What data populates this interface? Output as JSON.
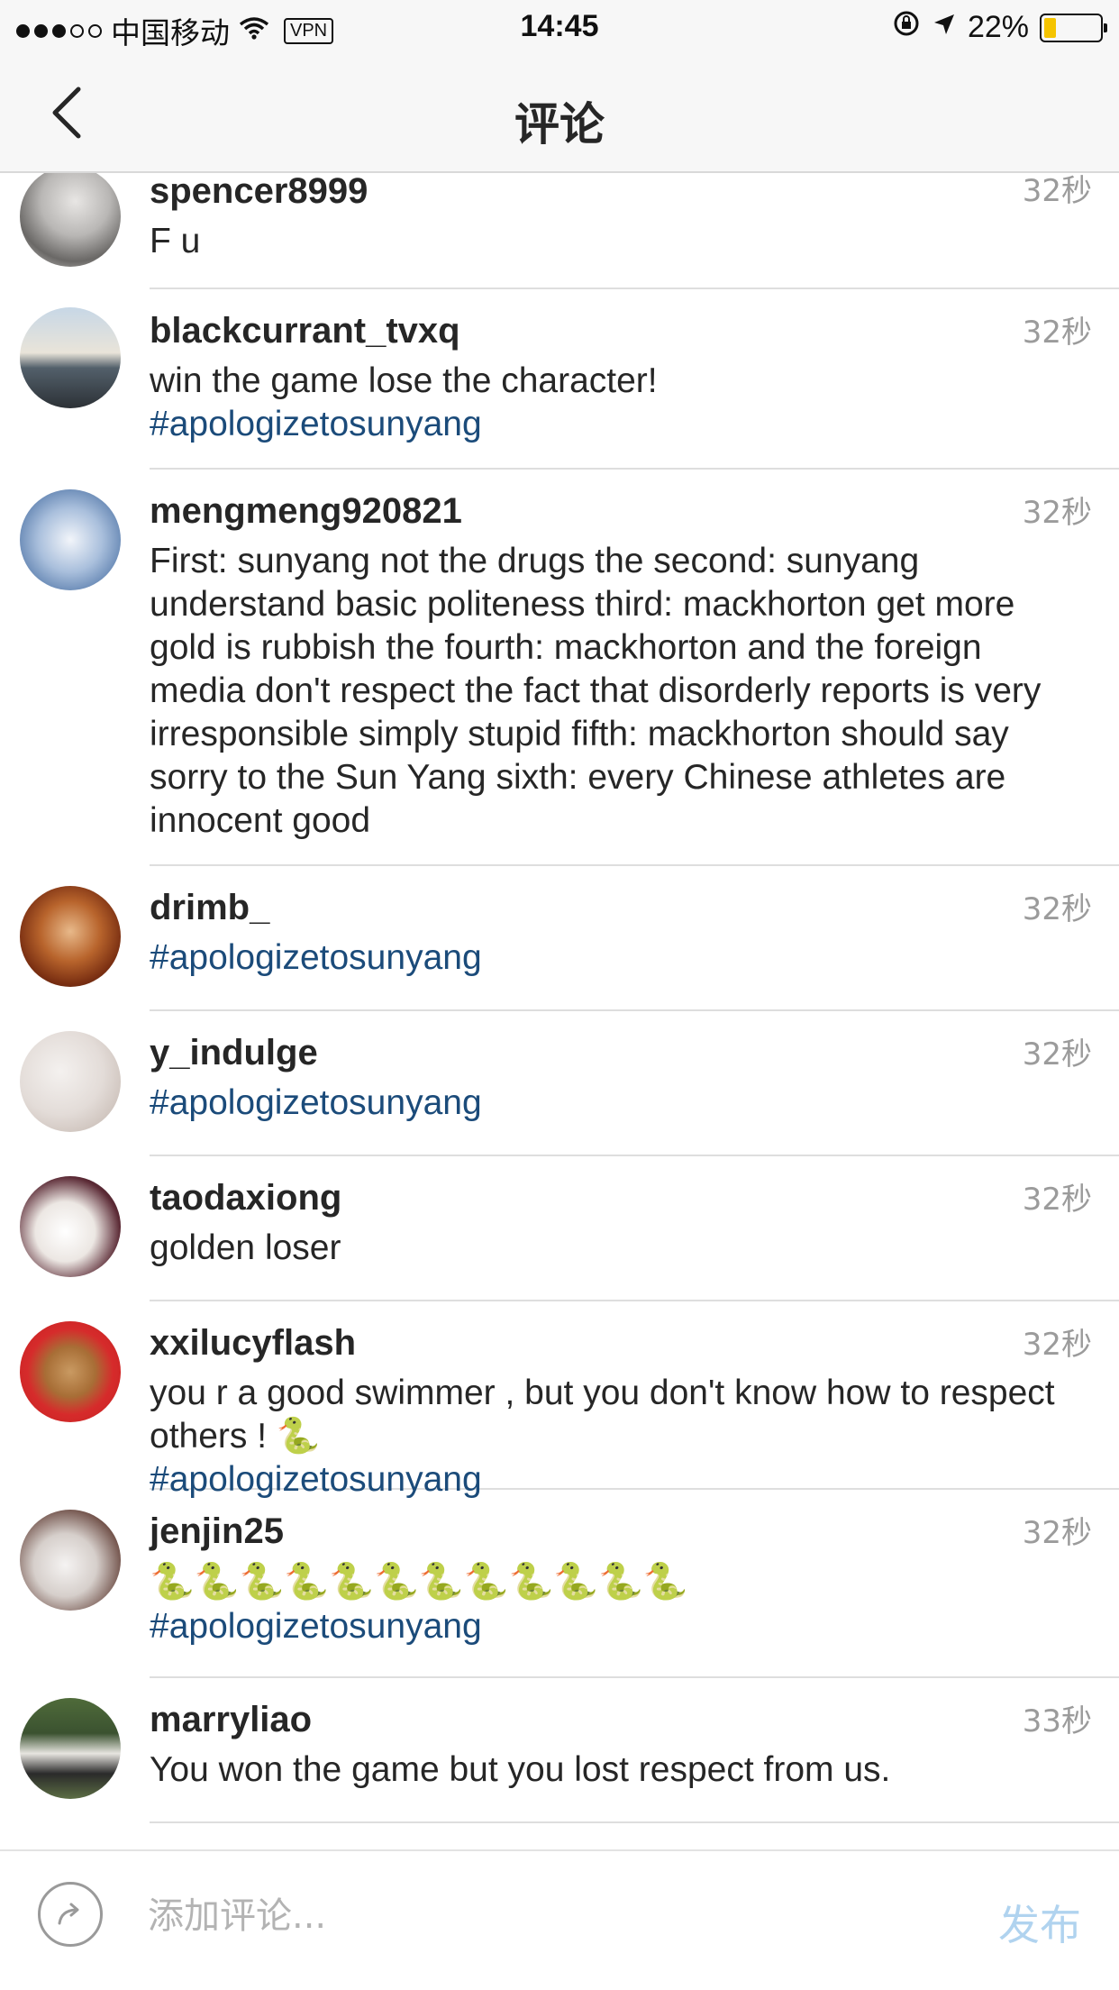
{
  "status_bar": {
    "carrier": "中国移动",
    "vpn": "VPN",
    "time": "14:45",
    "battery": "22%",
    "battery_level": 0.22
  },
  "nav": {
    "title": "评论"
  },
  "comments": [
    {
      "username": "spencer8999",
      "time": "32秒",
      "text": "F u",
      "hashtag": ""
    },
    {
      "username": "blackcurrant_tvxq",
      "time": "32秒",
      "text": "win the game lose the character!",
      "hashtag": "#apologizetosunyang"
    },
    {
      "username": "mengmeng920821",
      "time": "32秒",
      "text": "First: sunyang not the drugs the second: sunyang understand basic politeness third: mackhorton get more gold is rubbish the fourth: mackhorton and the foreign media don't respect the fact that disorderly reports is very irresponsible simply stupid fifth: mackhorton should say sorry to the Sun Yang sixth: every Chinese athletes are innocent good",
      "hashtag": ""
    },
    {
      "username": "drimb_",
      "time": "32秒",
      "text": "",
      "hashtag": "#apologizetosunyang"
    },
    {
      "username": "y_indulge",
      "time": "32秒",
      "text": "",
      "hashtag": "#apologizetosunyang"
    },
    {
      "username": "taodaxiong",
      "time": "32秒",
      "text": "golden loser",
      "hashtag": ""
    },
    {
      "username": "xxilucyflash",
      "time": "32秒",
      "text": "you r a good swimmer , but you don't know how to respect others ! 🐍",
      "hashtag": "#apologizetosunyang"
    },
    {
      "username": "jenjin25",
      "time": "32秒",
      "text": "🐍🐍🐍🐍🐍🐍🐍🐍🐍🐍🐍🐍",
      "hashtag": "#apologizetosunyang"
    },
    {
      "username": "marryliao",
      "time": "33秒",
      "text": "You won the game but you lost respect from us.",
      "hashtag": ""
    }
  ],
  "input_bar": {
    "placeholder": "添加评论...",
    "post_label": "发布"
  },
  "colors": {
    "hashtag": "#1b4b7a",
    "post_button_disabled": "#b0d3ef",
    "timestamp": "#9b9b9b"
  }
}
